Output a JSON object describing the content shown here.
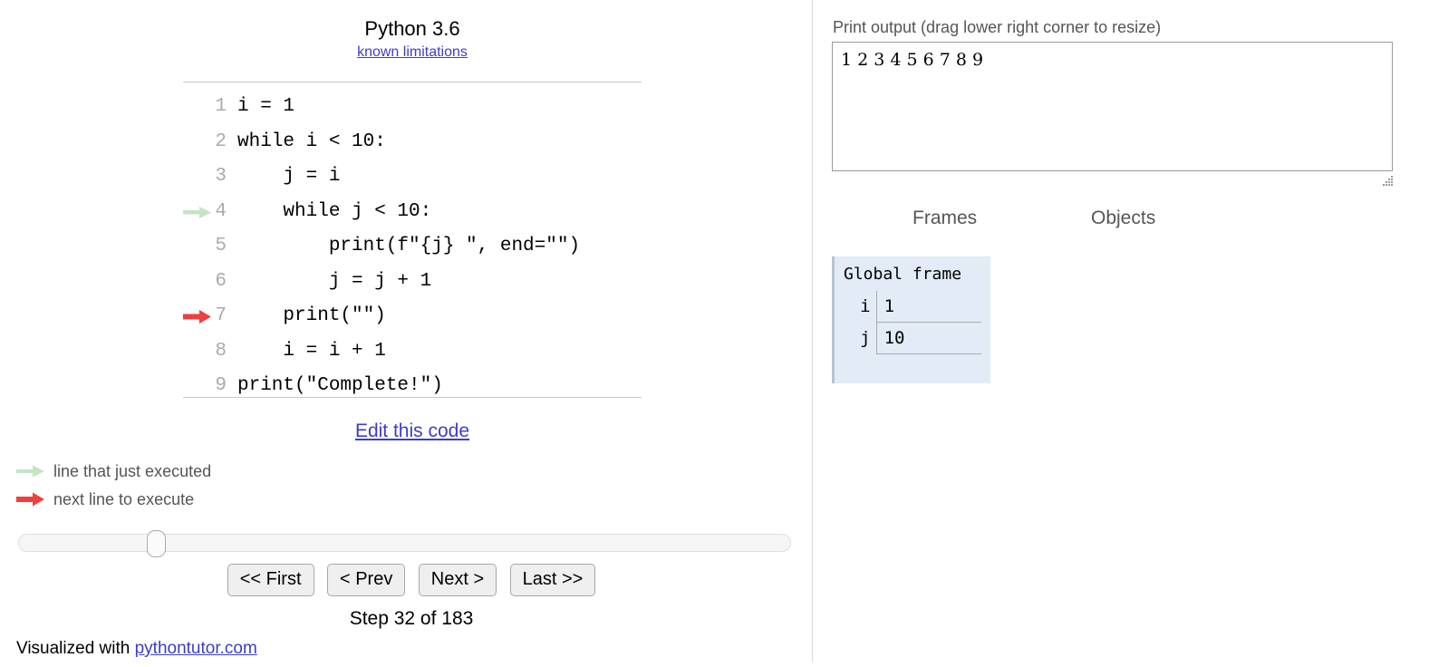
{
  "left_panel": {
    "python_version": "Python 3.6",
    "known_limitations_link": "known limitations",
    "code_lines": [
      {
        "number": "1",
        "text": "i = 1",
        "marker": "none"
      },
      {
        "number": "2",
        "text": "while i < 10:",
        "marker": "none"
      },
      {
        "number": "3",
        "text": "    j = i",
        "marker": "none"
      },
      {
        "number": "4",
        "text": "    while j < 10:",
        "marker": "just-executed"
      },
      {
        "number": "5",
        "text": "        print(f\"{j} \", end=\"\")",
        "marker": "none"
      },
      {
        "number": "6",
        "text": "        j = j + 1",
        "marker": "none"
      },
      {
        "number": "7",
        "text": "    print(\"\")",
        "marker": "next-to-execute"
      },
      {
        "number": "8",
        "text": "    i = i + 1",
        "marker": "none"
      },
      {
        "number": "9",
        "text": "print(\"Complete!\")",
        "marker": "none"
      }
    ],
    "edit_this_code_link": "Edit this code",
    "legend": {
      "just_executed": "line that just executed",
      "next_to_execute": "next line to execute"
    },
    "buttons": {
      "first": "<< First",
      "prev": "< Prev",
      "next": "Next >",
      "last": "Last >>"
    },
    "step_counter": "Step 32 of 183",
    "slider": {
      "current_step": 32,
      "total_steps": 183,
      "percent": 17
    },
    "footer": {
      "prefix": "Visualized with ",
      "link": "pythontutor.com"
    }
  },
  "right_panel": {
    "print_output_label": "Print output (drag lower right corner to resize)",
    "print_output_text": "1 2 3 4 5 6 7 8 9 ",
    "frames_header": "Frames",
    "objects_header": "Objects",
    "global_frame": {
      "title": "Global frame",
      "variables": [
        {
          "name": "i",
          "value": "1"
        },
        {
          "name": "j",
          "value": "10"
        }
      ]
    }
  },
  "colors": {
    "just_executed_arrow": "#c3e5c3",
    "next_arrow": "#ef3f3f",
    "link": "#3d3dc4",
    "frame_background": "#e2ebf6",
    "frame_border": "#b6c4d4",
    "muted_text": "#555555",
    "lineno_text": "#aaaaaa"
  }
}
